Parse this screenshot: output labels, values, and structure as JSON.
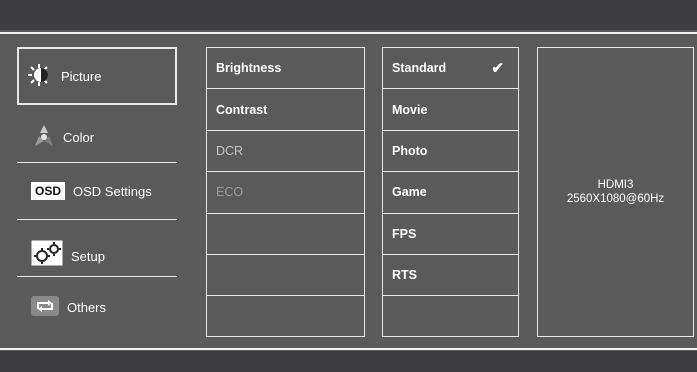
{
  "menu": {
    "picture": "Picture",
    "color": "Color",
    "osd_settings": "OSD Settings",
    "setup": "Setup",
    "others": "Others",
    "osd_icon_text": "OSD"
  },
  "picture_options": [
    "Brightness",
    "Contrast",
    "DCR",
    "ECO",
    "",
    "",
    ""
  ],
  "modes": [
    "Standard",
    "Movie",
    "Photo",
    "Game",
    "FPS",
    "RTS",
    ""
  ],
  "selected_mode": "Standard",
  "check_mark": "✔",
  "info": {
    "input": "HDMI3",
    "resolution": "2560X1080@60Hz"
  }
}
